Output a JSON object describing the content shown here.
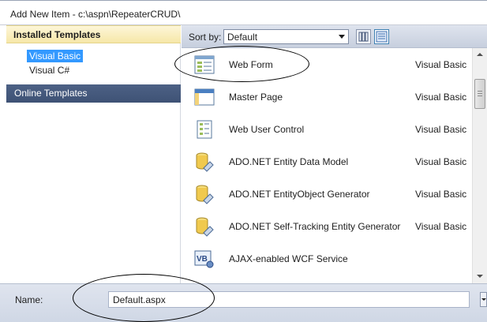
{
  "window": {
    "title": "Add New Item - c:\\aspn\\RepeaterCRUD\\"
  },
  "left_pane": {
    "installed_header": "Installed Templates",
    "tree_items": [
      {
        "label": "Visual Basic",
        "selected": true
      },
      {
        "label": "Visual C#",
        "selected": false
      }
    ],
    "online_header": "Online Templates"
  },
  "sortbar": {
    "sort_label": "Sort by:",
    "sort_value": "Default",
    "view_icons": [
      "medium-icons-view-icon",
      "details-view-icon"
    ]
  },
  "templates": [
    {
      "name": "Web Form",
      "language": "Visual Basic",
      "icon": "web-form-icon"
    },
    {
      "name": "Master Page",
      "language": "Visual Basic",
      "icon": "master-page-icon"
    },
    {
      "name": "Web User Control",
      "language": "Visual Basic",
      "icon": "web-user-control-icon"
    },
    {
      "name": "ADO.NET Entity Data Model",
      "language": "Visual Basic",
      "icon": "database-icon"
    },
    {
      "name": "ADO.NET EntityObject Generator",
      "language": "Visual Basic",
      "icon": "database-icon"
    },
    {
      "name": "ADO.NET Self-Tracking Entity Generator",
      "language": "Visual Basic",
      "icon": "database-icon"
    },
    {
      "name": "AJAX-enabled WCF Service",
      "language": "",
      "icon": "wcf-service-icon"
    }
  ],
  "bottom": {
    "name_label": "Name:",
    "name_value": "Default.aspx"
  },
  "colors": {
    "installed_header_bg": "#f6e7a8",
    "online_header_bg": "#3e5275",
    "selection": "#3399ff"
  }
}
